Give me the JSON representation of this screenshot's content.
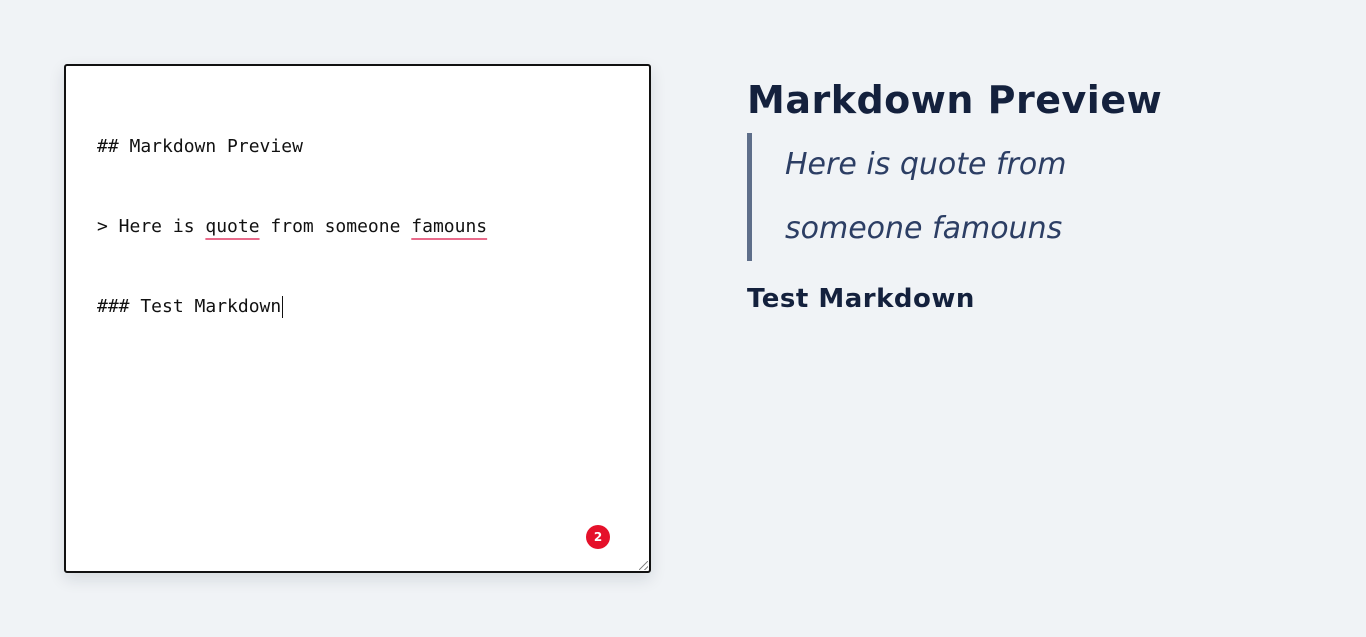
{
  "editor": {
    "line1": "## Markdown Preview",
    "line2": {
      "prefix": "> Here is ",
      "word1": "quote",
      "middle": " from someone ",
      "word2": "famouns"
    },
    "line3": "### Test Markdown",
    "error_count": "2"
  },
  "preview": {
    "heading2": "Markdown Preview",
    "blockquote": "Here is quote from someone famouns",
    "heading3": "Test Markdown"
  },
  "colors": {
    "background": "#f0f3f6",
    "heading": "#14213d",
    "quote_text": "#2c3e64",
    "quote_border": "#5e6e8a",
    "spellcheck_underline": "#e86a8a",
    "badge": "#e5102a"
  },
  "icons": {
    "resize": "resize-handle-icon",
    "caret": "text-caret"
  }
}
